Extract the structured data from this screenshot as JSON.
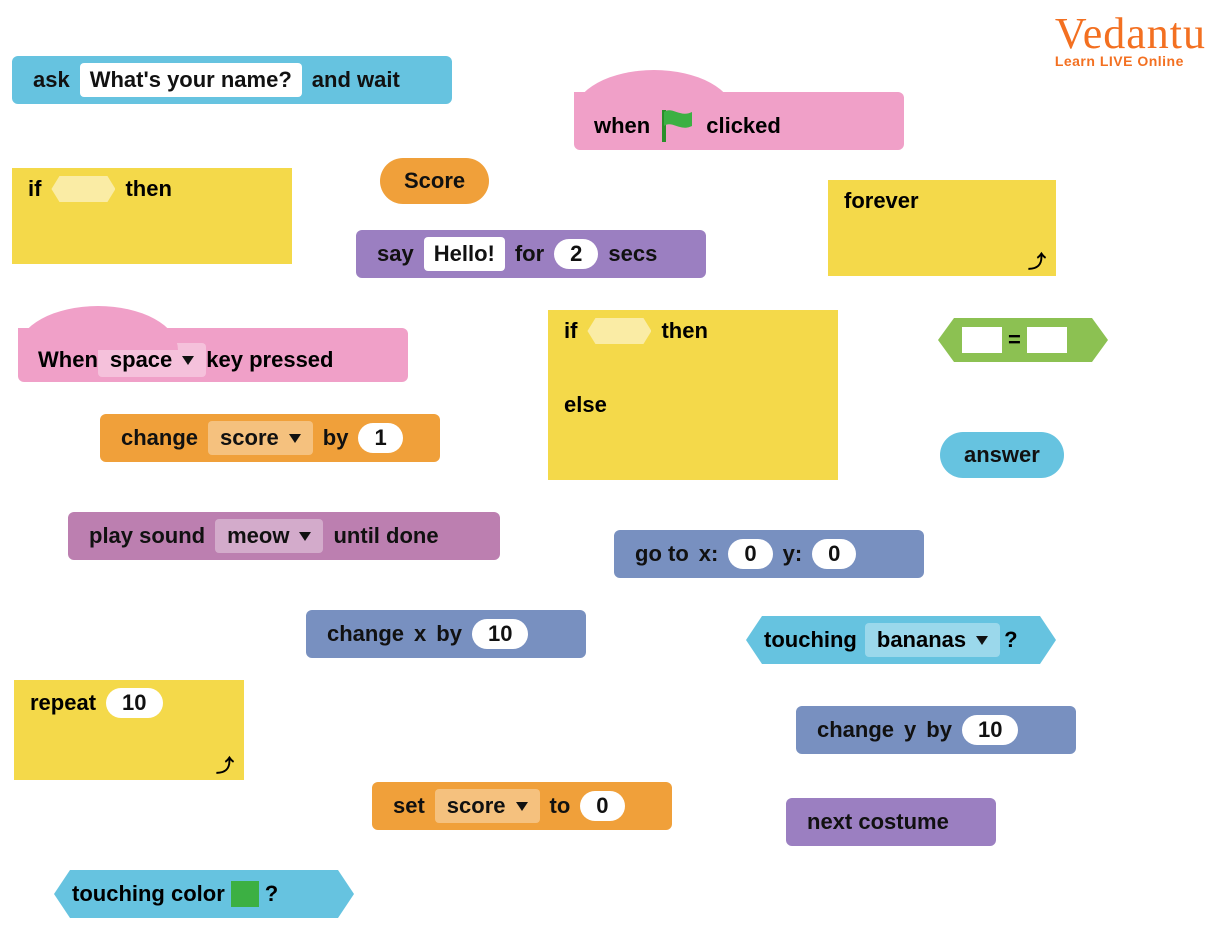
{
  "logo": {
    "brand": "Vedantu",
    "tagline": "Learn LIVE Online"
  },
  "ask": {
    "label1": "ask",
    "prompt": "What's your name?",
    "label2": "and wait"
  },
  "if1": {
    "label1": "if",
    "label2": "then"
  },
  "score_var": {
    "name": "Score"
  },
  "say": {
    "label1": "say",
    "text": "Hello!",
    "label2": "for",
    "secs": "2",
    "label3": "secs"
  },
  "forever": {
    "label": "forever"
  },
  "when_flag": {
    "label1": "when",
    "label2": "clicked"
  },
  "when_key": {
    "label1": "When",
    "key": "space",
    "label2": "key pressed"
  },
  "if_else": {
    "label1": "if",
    "label2": "then",
    "label3": "else"
  },
  "equals": {
    "op": "="
  },
  "change_score": {
    "label1": "change",
    "var": "score",
    "label2": "by",
    "val": "1"
  },
  "answer": {
    "label": "answer"
  },
  "play_sound": {
    "label1": "play sound",
    "sound": "meow",
    "label2": "until done"
  },
  "goto": {
    "label1": "go to",
    "x_label": "x:",
    "x": "0",
    "y_label": "y:",
    "y": "0"
  },
  "change_x": {
    "label1": "change",
    "var": "x",
    "label2": "by",
    "val": "10"
  },
  "touching": {
    "label1": "touching",
    "target": "bananas",
    "q": "?"
  },
  "repeat": {
    "label": "repeat",
    "times": "10"
  },
  "change_y": {
    "label1": "change",
    "var": "y",
    "label2": "by",
    "val": "10"
  },
  "set_score": {
    "label1": "set",
    "var": "score",
    "label2": "to",
    "val": "0"
  },
  "next_costume": {
    "label": "next costume"
  },
  "touching_color": {
    "label1": "touching color",
    "q": "?"
  },
  "colors": {
    "green": "#3cb043"
  }
}
